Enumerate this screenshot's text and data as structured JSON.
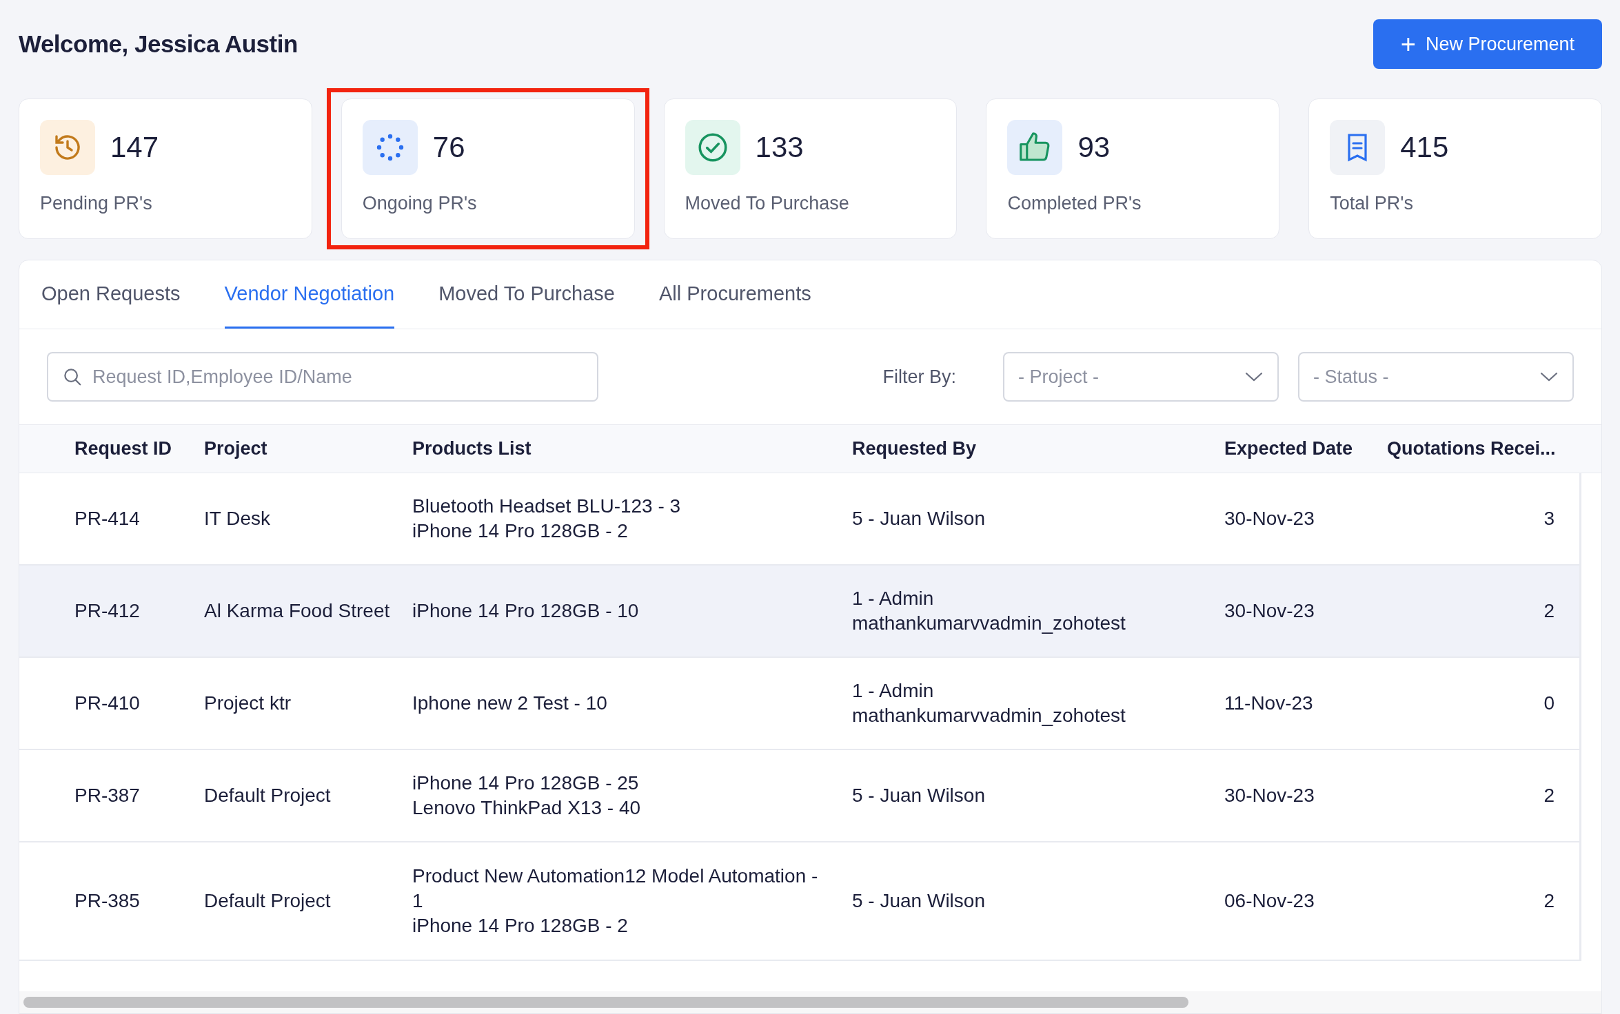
{
  "header": {
    "title": "Welcome, Jessica Austin",
    "action": {
      "icon": "+",
      "label": "New Procurement"
    }
  },
  "stats": [
    {
      "kind": "pending",
      "value": "147",
      "label": "Pending PR's",
      "highlighted": false
    },
    {
      "kind": "ongoing",
      "value": "76",
      "label": "Ongoing PR's",
      "highlighted": true
    },
    {
      "kind": "moved",
      "value": "133",
      "label": "Moved To Purchase",
      "highlighted": false
    },
    {
      "kind": "completed",
      "value": "93",
      "label": "Completed PR's",
      "highlighted": false
    },
    {
      "kind": "total",
      "value": "415",
      "label": "Total PR's",
      "highlighted": false
    }
  ],
  "tabs": [
    {
      "label": "Open Requests",
      "selected": false
    },
    {
      "label": "Vendor Negotiation",
      "selected": true
    },
    {
      "label": "Moved To Purchase",
      "selected": false
    },
    {
      "label": "All Procurements",
      "selected": false
    }
  ],
  "search": {
    "placeholder": "Request ID,Employee ID/Name"
  },
  "filter": {
    "label": "Filter By:",
    "selects": [
      {
        "placeholder": "- Project -"
      },
      {
        "placeholder": "- Status -"
      }
    ]
  },
  "table": {
    "columns": [
      "Request ID",
      "Project",
      "Products List",
      "Requested By",
      "Expected Date",
      "Quotations Recei..."
    ],
    "rows": [
      {
        "id": "PR-414",
        "project": "IT Desk",
        "products": [
          "Bluetooth Headset BLU-123 - 3",
          "iPhone 14 Pro 128GB - 2"
        ],
        "requested_by": "5 - Juan Wilson",
        "date": "30-Nov-23",
        "quotations": "3",
        "highlighted": false
      },
      {
        "id": "PR-412",
        "project": "Al Karma Food Street",
        "products": [
          "iPhone 14 Pro 128GB - 10"
        ],
        "requested_by": "1 - Admin mathankumarvvadmin_zohotest",
        "date": "30-Nov-23",
        "quotations": "2",
        "highlighted": true
      },
      {
        "id": "PR-410",
        "project": "Project ktr",
        "products": [
          "Iphone new 2 Test - 10"
        ],
        "requested_by": "1 - Admin mathankumarvvadmin_zohotest",
        "date": "11-Nov-23",
        "quotations": "0",
        "highlighted": false
      },
      {
        "id": "PR-387",
        "project": "Default Project",
        "products": [
          "iPhone 14 Pro 128GB - 25",
          "Lenovo ThinkPad X13 - 40"
        ],
        "requested_by": "5 - Juan Wilson",
        "date": "30-Nov-23",
        "quotations": "2",
        "highlighted": false
      },
      {
        "id": "PR-385",
        "project": "Default Project",
        "products": [
          "Product New Automation12 Model Automation - 1",
          "iPhone 14 Pro 128GB - 2"
        ],
        "requested_by": "5 - Juan Wilson",
        "date": "06-Nov-23",
        "quotations": "2",
        "highlighted": false
      }
    ]
  }
}
